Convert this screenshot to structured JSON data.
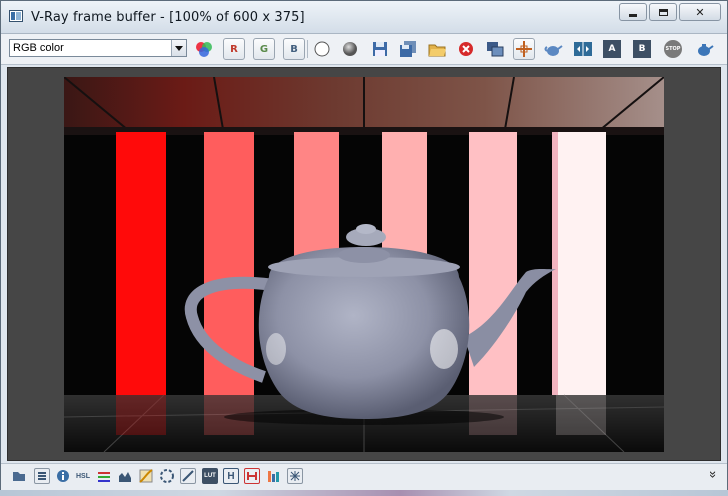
{
  "window": {
    "title": "V-Ray frame buffer - [100% of 600 x 375]",
    "icon": "vfb-icon"
  },
  "window_controls": {
    "minimize": "minimize-icon",
    "maximize": "maximize-icon",
    "close": "close-icon",
    "close_glyph": "✕"
  },
  "toolbar": {
    "channel_value": "RGB color",
    "channel_r": "R",
    "channel_g": "G",
    "channel_b": "B",
    "ab_a": "A",
    "ab_b": "B",
    "stop": "STOP"
  },
  "statusbar": {
    "hsl": "HSL",
    "lut": "LUT",
    "h": "H",
    "expand": "»"
  },
  "colors": {
    "red_channel": "#c0392b",
    "green_channel": "#5a8a4a",
    "blue_channel": "#44607f",
    "stop": "#d22"
  }
}
